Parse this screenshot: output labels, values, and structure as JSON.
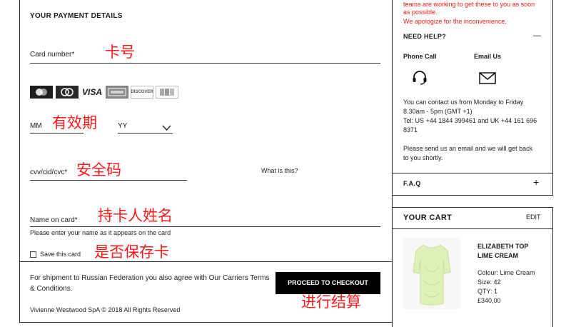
{
  "payment": {
    "title": "YOUR PAYMENT DETAILS",
    "card_number_label": "Card number*",
    "mm_label": "MM",
    "yy_label": "YY",
    "cvv_label": "cvv/cid/cvc*",
    "what_is_this": "What is this?",
    "name_label": "Name on card*",
    "name_hint": "Please enter your name as it appears on the card",
    "save_card_label": "Save this card",
    "card_logos": [
      "mastercard-icon",
      "maestro-icon",
      "VISA",
      "AMEX",
      "DISCOVER",
      "JCB"
    ],
    "visa_text": "VISA",
    "discover_text": "DISCOVER"
  },
  "footer": {
    "shipping_note": "For shipment to Russian Federation you also agree with Our Carriers Terms & Conditions.",
    "proceed_button": "PROCEED TO CHECKOUT",
    "copyright": "Vivienne Westwood SpA © 2018 All Rights Reserved"
  },
  "annotations": {
    "card_number": "卡号",
    "expiry": "有效期",
    "cvv": "安全码",
    "name": "持卡人姓名",
    "save": "是否保存卡",
    "checkout": "进行结算"
  },
  "help": {
    "notice_line1": "teams are working to get these to you as soon",
    "notice_line2": "as possible.",
    "notice_line3": "We apologize for the inconvenience.",
    "title": "NEED HELP?",
    "collapse_symbol": "—",
    "phone_label": "Phone Call",
    "email_label": "Email Us",
    "contact_line1": "You can contact us from Monday to Friday",
    "contact_line2": "8.30am - 5pm (GMT +1)",
    "contact_line3": "Tel: US +44 1844 399461 and UK +44 161 696",
    "contact_line4": "8371",
    "email_line1": "Please send us an email and we will get back",
    "email_line2": "to you shortly.",
    "faq_label": "F.A.Q",
    "faq_expand": "+"
  },
  "cart": {
    "title": "YOUR CART",
    "edit": "EDIT",
    "item_name_line1": "ELIZABETH TOP",
    "item_name_line2": "LIME CREAM",
    "colour": "Colour: Lime Cream",
    "size": "Size: 42",
    "qty": "QTY: 1",
    "price": "£340,00"
  },
  "colors": {
    "notice": "#e8221b",
    "annotation": "#ff1a1a",
    "button": "#000000",
    "product": "#dff0b8"
  }
}
